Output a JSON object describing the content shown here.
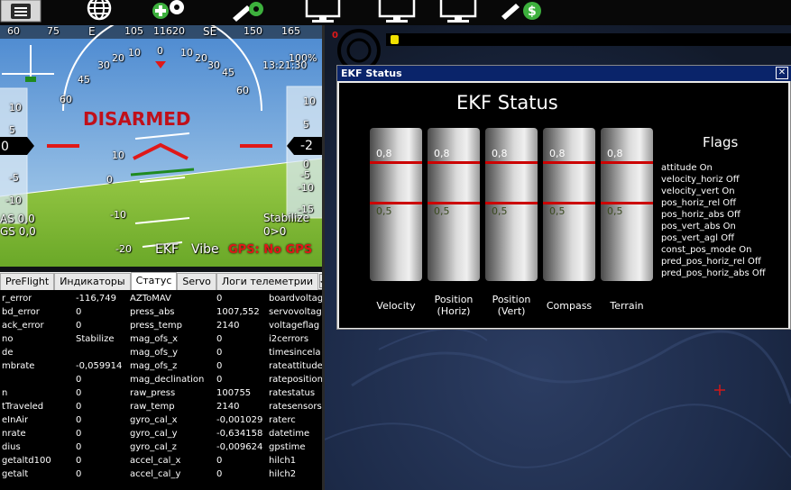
{
  "toolbar": {
    "buttons": [
      {
        "icon": "flight-data-icon"
      },
      {
        "icon": "flight-plan-globe-icon"
      },
      {
        "icon": "initial-setup-icon"
      },
      {
        "icon": "config-tuning-icon"
      },
      {
        "icon": "simulation-icon"
      },
      {
        "icon": "terminal-icon"
      },
      {
        "icon": "help-icon"
      },
      {
        "icon": "donate-icon"
      }
    ]
  },
  "hud": {
    "compass": [
      "60",
      "75",
      "E",
      "105",
      "11620",
      "SE",
      "150",
      "165"
    ],
    "battery": "100%",
    "time": "13:21:30",
    "status": "DISARMED",
    "speed_scale": [
      "10",
      "5",
      "0",
      "-5",
      "-10"
    ],
    "speed_value": "0",
    "alt_scale": [
      "10",
      "5",
      "0",
      "-5",
      "-10",
      "-15"
    ],
    "alt_value": "-2",
    "pitch_scale": [
      "10",
      "0",
      "-10",
      "-20"
    ],
    "roll_scale": [
      "60",
      "45",
      "30",
      "20",
      "10",
      "0",
      "10",
      "20",
      "30",
      "45",
      "60"
    ],
    "airspeed": "AS 0,0",
    "groundspeed": "GS 0,0",
    "mode": "Stabilize",
    "wp": "0>0",
    "ekf": "EKF",
    "vibe": "Vibe",
    "gps": "GPS: No GPS"
  },
  "tabs": [
    "PreFlight",
    "Индикаторы",
    "Статус",
    "Servo",
    "Логи телеметрии"
  ],
  "active_tab": "Статус",
  "status_rows": [
    [
      "r_error",
      "-116,749",
      "AZToMAV",
      "0",
      "boardvoltag"
    ],
    [
      "bd_error",
      "0",
      "press_abs",
      "1007,552",
      "servovoltag"
    ],
    [
      "ack_error",
      "0",
      "press_temp",
      "2140",
      "voltageflag"
    ],
    [
      "no",
      "Stabilize",
      "mag_ofs_x",
      "0",
      "i2cerrors"
    ],
    [
      "de",
      "",
      "mag_ofs_y",
      "0",
      "timesincela"
    ],
    [
      "mbrate",
      "-0,059914",
      "mag_ofs_z",
      "0",
      "rateattitude"
    ],
    [
      "",
      "0",
      "mag_declination",
      "0",
      "rateposition"
    ],
    [
      "n",
      "0",
      "raw_press",
      "100755",
      "ratestatus"
    ],
    [
      "tTraveled",
      "0",
      "raw_temp",
      "2140",
      "ratesensors"
    ],
    [
      "eInAir",
      "0",
      "gyro_cal_x",
      "-0,001029",
      "raterc"
    ],
    [
      "nrate",
      "0",
      "gyro_cal_y",
      "-0,634158",
      "datetime"
    ],
    [
      "dius",
      "0",
      "gyro_cal_z",
      "-0,009624",
      "gpstime"
    ],
    [
      "getaltd100",
      "0",
      "accel_cal_x",
      "0",
      "hilch1"
    ],
    [
      "getalt",
      "0",
      "accel_cal_y",
      "0",
      "hilch2"
    ]
  ],
  "map": {
    "top_indicator": "0"
  },
  "ekf_window": {
    "title": "EKF Status",
    "close": "✕",
    "heading": "EKF Status",
    "flags_title": "Flags",
    "threshold_high": "0,8",
    "threshold_low": "0,5",
    "bars": [
      {
        "label": "Velocity",
        "value": 0
      },
      {
        "label": "Position\n(Horiz)",
        "value": 0
      },
      {
        "label": "Position\n(Vert)",
        "value": 0
      },
      {
        "label": "Compass",
        "value": 0
      },
      {
        "label": "Terrain",
        "value": 0
      }
    ],
    "flags": [
      "attitude On",
      "velocity_horiz Off",
      "velocity_vert On",
      "pos_horiz_rel Off",
      "pos_horiz_abs Off",
      "pos_vert_abs On",
      "pos_vert_agl Off",
      "const_pos_mode On",
      "pred_pos_horiz_rel Off",
      "pred_pos_horiz_abs Off"
    ]
  },
  "colors": {
    "sky": "#6aa6d6",
    "ground": "#8cc43c",
    "disarmed": "#c0101a",
    "gps_error": "#e01818",
    "title_bar": "#0a246a",
    "threshold": "#cc0000"
  }
}
